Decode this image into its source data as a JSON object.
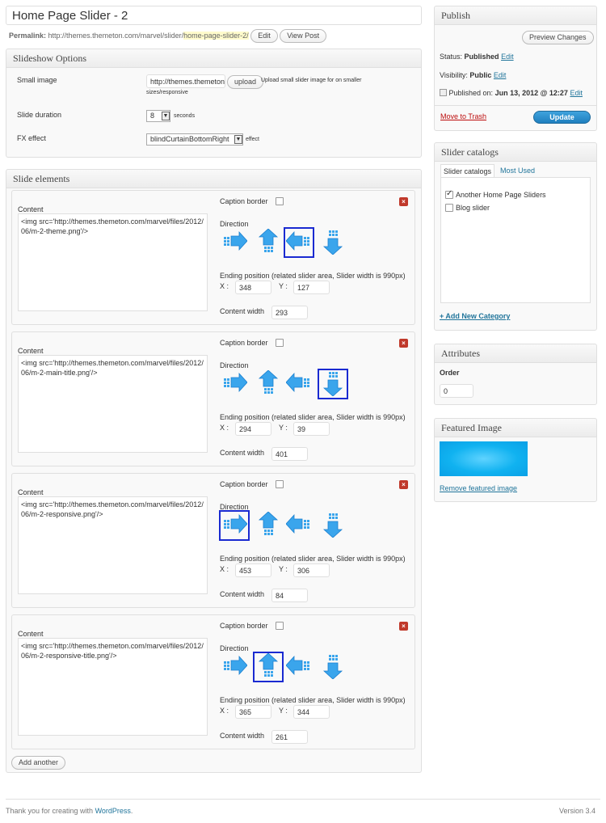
{
  "post_title": "Home Page Slider - 2",
  "permalink": {
    "label": "Permalink:",
    "base": "http://themes.themeton.com/marvel/slider/",
    "slug": "home-page-slider-2/",
    "edit_label": "Edit",
    "view_label": "View Post"
  },
  "slideshow": {
    "title": "Slideshow Options",
    "small_image_label": "Small image",
    "small_image_value": "http://themes.themeton.",
    "upload_label": "upload",
    "upload_hint_line1": "Upload small slider image for on smaller",
    "upload_hint_line2": "sizes/responsive",
    "duration_label": "Slide duration",
    "duration_value": "8",
    "duration_unit": "seconds",
    "fx_label": "FX effect",
    "fx_value": "blindCurtainBottomRight",
    "fx_unit": "effect"
  },
  "slide_elements": {
    "title": "Slide elements",
    "content_label": "Content",
    "caption_label": "Caption border",
    "direction_label": "Direction",
    "ending_label": "Ending position (related slider area, Slider width is 990px)",
    "x_label": "X :",
    "y_label": "Y :",
    "width_label": "Content width",
    "delete_icon": "×",
    "add_label": "Add another",
    "items": [
      {
        "content": "<img src='http://themes.themeton.com/marvel/files/2012/06/m-2-theme.png'/>",
        "x": "348",
        "y": "127",
        "width": "293",
        "direction": "left"
      },
      {
        "content": "<img src='http://themes.themeton.com/marvel/files/2012/06/m-2-main-title.png'/>",
        "x": "294",
        "y": "39",
        "width": "401",
        "direction": "down"
      },
      {
        "content": "<img src='http://themes.themeton.com/marvel/files/2012/06/m-2-responsive.png'/>",
        "x": "453",
        "y": "306",
        "width": "84",
        "direction": "right"
      },
      {
        "content": "<img src='http://themes.themeton.com/marvel/files/2012/06/m-2-responsive-title.png'/>",
        "x": "365",
        "y": "344",
        "width": "261",
        "direction": "up"
      }
    ]
  },
  "publish": {
    "title": "Publish",
    "preview_label": "Preview Changes",
    "status_label": "Status:",
    "status_value": "Published",
    "visibility_label": "Visibility:",
    "visibility_value": "Public",
    "published_label": "Published on:",
    "published_value": "Jun 13, 2012 @ 12:27",
    "edit_label": "Edit",
    "trash_label": "Move to Trash",
    "update_label": "Update"
  },
  "catalogs": {
    "title": "Slider catalogs",
    "tab_all": "Slider catalogs",
    "tab_most": "Most Used",
    "items": [
      {
        "label": "Another Home Page Sliders",
        "checked": true
      },
      {
        "label": "Blog slider",
        "checked": false
      }
    ],
    "add_label": "+ Add New Category"
  },
  "attributes": {
    "title": "Attributes",
    "order_label": "Order",
    "order_value": "0"
  },
  "featured": {
    "title": "Featured Image",
    "remove_label": "Remove featured image"
  },
  "footer": {
    "thanks_text": "Thank you for creating with ",
    "wp_link": "WordPress",
    "thanks_end": ".",
    "version": "Version 3.4"
  },
  "colors": {
    "link": "#21759b",
    "update_button": "#2a8fcf",
    "selected_border": "#1a2ad1",
    "arrow_blue": "#3aa5ec"
  },
  "icons": {
    "arrow_right": "arrow-right-icon",
    "arrow_up": "arrow-up-icon",
    "arrow_left": "arrow-left-icon",
    "arrow_down": "arrow-down-icon",
    "delete": "delete-icon",
    "calendar": "calendar-icon"
  }
}
